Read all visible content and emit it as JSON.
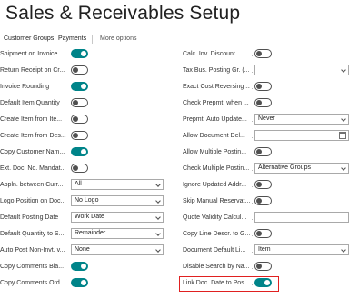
{
  "title": "Sales & Receivables Setup",
  "actions": [
    "Customer Groups",
    "Payments",
    "More options"
  ],
  "left_rows": [
    {
      "label": "Shipment on Invoice",
      "kind": "toggle",
      "on": true
    },
    {
      "label": "Return Receipt on Cr...",
      "kind": "toggle",
      "on": false
    },
    {
      "label": "Invoice Rounding",
      "kind": "toggle",
      "on": true
    },
    {
      "label": "Default Item Quantity",
      "kind": "toggle",
      "on": false
    },
    {
      "label": "Create Item from Ite...",
      "kind": "toggle",
      "on": false
    },
    {
      "label": "Create Item from Des...",
      "kind": "toggle",
      "on": false
    },
    {
      "label": "Copy Customer Nam...",
      "kind": "toggle",
      "on": true
    },
    {
      "label": "Ext. Doc. No. Mandat...",
      "kind": "toggle",
      "on": false
    },
    {
      "label": "Appln. between Curr...",
      "kind": "select",
      "value": "All"
    },
    {
      "label": "Logo Position on Doc...",
      "kind": "select",
      "value": "No Logo"
    },
    {
      "label": "Default Posting Date",
      "kind": "select",
      "value": "Work Date"
    },
    {
      "label": "Default Quantity to S...",
      "kind": "select",
      "value": "Remainder"
    },
    {
      "label": "Auto Post Non-Invt. v...",
      "kind": "select",
      "value": "None"
    },
    {
      "label": "Copy Comments Bla...",
      "kind": "toggle",
      "on": true
    },
    {
      "label": "Copy Comments Ord...",
      "kind": "toggle",
      "on": true
    }
  ],
  "right_rows": [
    {
      "label": "Calc. Inv. Discount",
      "kind": "toggle",
      "on": false
    },
    {
      "label": "Tax Bus. Posting Gr. (...",
      "kind": "select",
      "value": ""
    },
    {
      "label": "Exact Cost Reversing ...",
      "kind": "toggle",
      "on": false
    },
    {
      "label": "Check Prepmt. when ...",
      "kind": "toggle",
      "on": false
    },
    {
      "label": "Prepmt. Auto Update...",
      "kind": "select",
      "value": "Never"
    },
    {
      "label": "Allow Document Del...",
      "kind": "date",
      "value": ""
    },
    {
      "label": "Allow Multiple Postin...",
      "kind": "toggle",
      "on": false
    },
    {
      "label": "Check Multiple Postin...",
      "kind": "select",
      "value": "Alternative Groups"
    },
    {
      "label": "Ignore Updated Addr...",
      "kind": "toggle",
      "on": false
    },
    {
      "label": "Skip Manual Reservat...",
      "kind": "toggle",
      "on": false
    },
    {
      "label": "Quote Validity Calcul...",
      "kind": "text",
      "value": ""
    },
    {
      "label": "Copy Line Descr. to G...",
      "kind": "toggle",
      "on": false
    },
    {
      "label": "Document Default Li...",
      "kind": "select",
      "value": "Item"
    },
    {
      "label": "Disable Search by Na...",
      "kind": "toggle",
      "on": false
    },
    {
      "label": "Link Doc. Date to Pos...",
      "kind": "toggle",
      "on": true
    }
  ],
  "colors": {
    "toggle_on": "#008489",
    "highlight": "#e02020"
  }
}
